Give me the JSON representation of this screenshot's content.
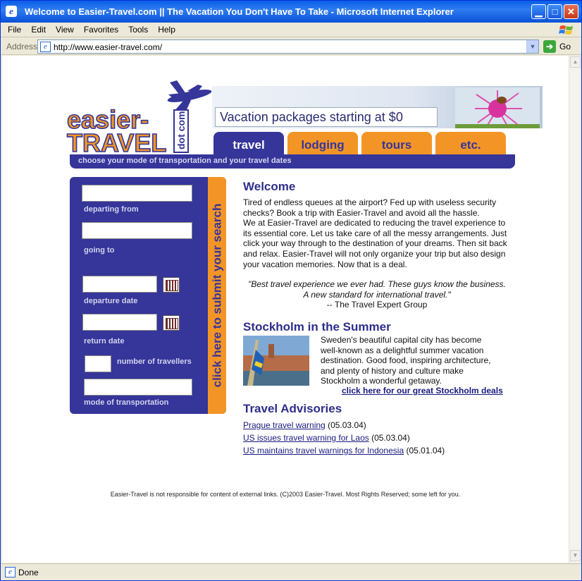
{
  "window": {
    "title": "Welcome to Easier-Travel.com || The Vacation You Don't Have To Take - Microsoft Internet Explorer",
    "min_icon": "minimize-icon",
    "max_icon": "maximize-icon",
    "close_icon": "close-icon"
  },
  "menu": [
    "File",
    "Edit",
    "View",
    "Favorites",
    "Tools",
    "Help"
  ],
  "address": {
    "label": "Address",
    "url": "http://www.easier-travel.com/",
    "go": "Go"
  },
  "status": {
    "text": "Done"
  },
  "page": {
    "logo": {
      "line1": "easier-",
      "line2": "TRAVEL",
      "side": "dot com"
    },
    "banner_text": "Vacation packages starting at $0",
    "tabs": [
      {
        "label": "travel",
        "active": true
      },
      {
        "label": "lodging",
        "active": false
      },
      {
        "label": "tours",
        "active": false
      },
      {
        "label": "etc.",
        "active": false
      }
    ],
    "subbar": "choose your mode of transportation and your travel dates",
    "search": {
      "submit_label": "click here to submit your search",
      "departing_from": "departing from",
      "going_to": "going to",
      "departure_date": "departure date",
      "return_date": "return date",
      "travellers": "number of travellers",
      "mode": "mode of transportation"
    },
    "welcome": {
      "title": "Welcome",
      "p1": "Tired of endless queues at the airport? Fed up with useless security checks? Book a trip with Easier-Travel and avoid all the hassle.",
      "p2": "We at Easier-Travel are dedicated to reducing the travel experience to its essential core. Let us take care of all the messy arrangements. Just click your way through to the destination of your dreams. Then sit back and relax. Easier-Travel will not only organize your trip but also design your vacation memories. Now that is a deal.",
      "quote1": "\"Best travel experience we ever had. These guys know the business.",
      "quote2": "A new standard for international travel.\"",
      "quote_by": "-- The Travel Expert Group"
    },
    "stockholm": {
      "title": "Stockholm in the Summer",
      "text": "Sweden's beautiful capital city has become well-known as a delightful summer vacation destination. Good food, inspiring architecture, and plenty of history and culture make Stockholm a wonderful getaway.",
      "link": "click here for our great Stockholm deals"
    },
    "advisories": {
      "title": "Travel Advisories",
      "items": [
        {
          "link": "Prague travel warning",
          "date": "(05.03.04)"
        },
        {
          "link": "US issues travel warning for Laos",
          "date": "(05.03.04)"
        },
        {
          "link": "US maintains travel warnings for Indonesia",
          "date": "(05.01.04)"
        }
      ]
    },
    "footer": "Easier-Travel is not responsible for content of external links. (C)2003 Easier-Travel. Most Rights Reserved; some left for you."
  },
  "colors": {
    "navy": "#35359a",
    "orange": "#f39526"
  }
}
